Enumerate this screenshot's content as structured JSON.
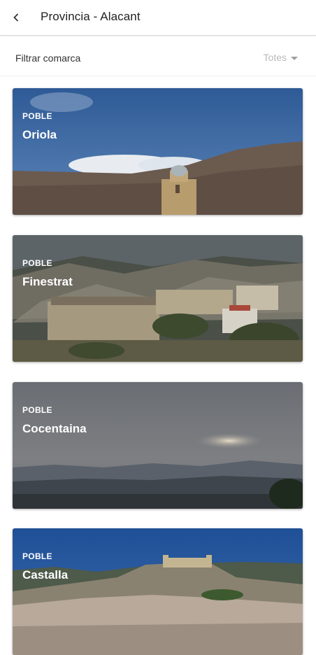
{
  "header": {
    "title": "Provincia - Alacant"
  },
  "filter": {
    "label": "Filtrar comarca",
    "selected": "Totes"
  },
  "cards": [
    {
      "type": "POBLE",
      "name": "Oriola"
    },
    {
      "type": "POBLE",
      "name": "Finestrat"
    },
    {
      "type": "POBLE",
      "name": "Cocentaina"
    },
    {
      "type": "POBLE",
      "name": "Castalla"
    }
  ]
}
